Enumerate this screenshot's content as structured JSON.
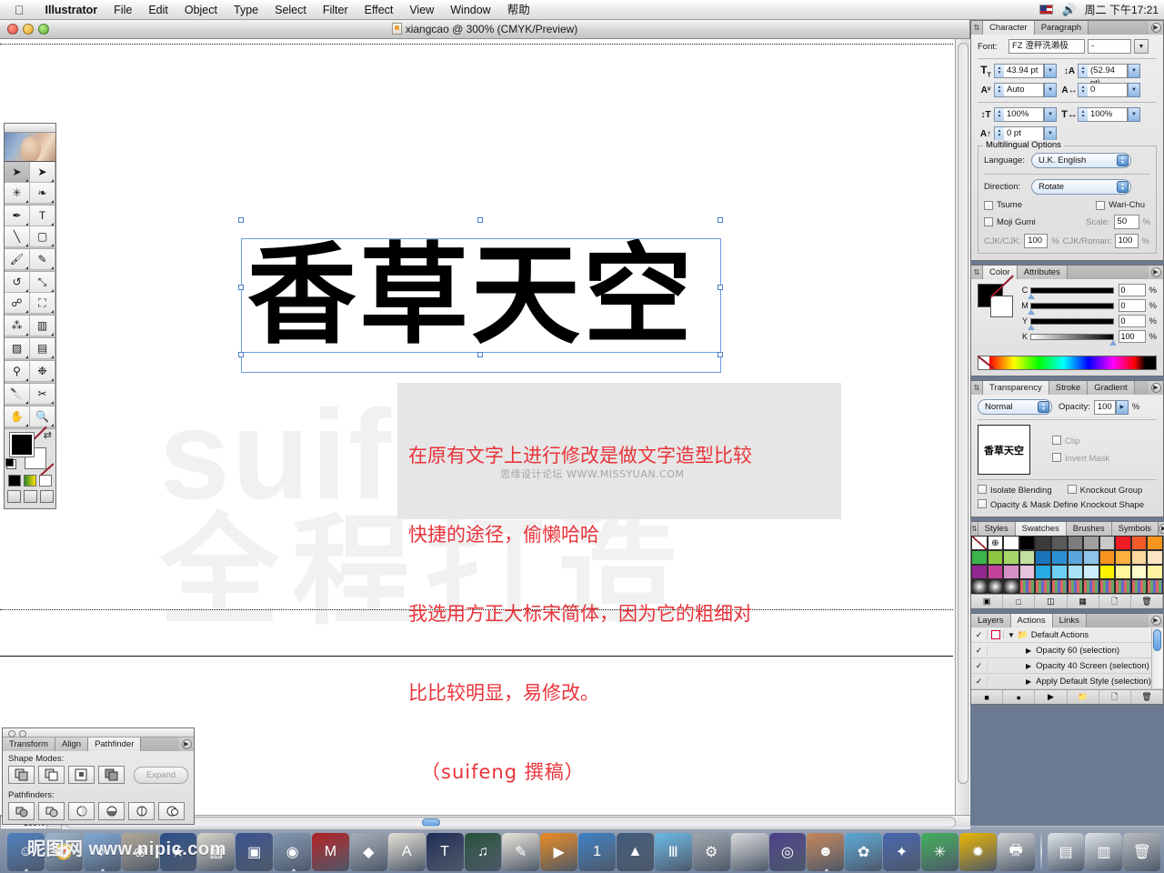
{
  "menubar": {
    "apple": "apple-logo",
    "items": [
      "Illustrator",
      "File",
      "Edit",
      "Object",
      "Type",
      "Select",
      "Filter",
      "Effect",
      "View",
      "Window",
      "帮助"
    ],
    "clock": "周二 下午17:21"
  },
  "document": {
    "title": "xiangcao @ 300% (CMYK/Preview)",
    "artwork_text": "香草天空",
    "zoom_field": "300%",
    "background_watermark_line1": "suifeng",
    "background_watermark_line2": "全程打造",
    "annotation": {
      "line1": "在原有文字上进行修改是做文字造型比较",
      "line2": "快捷的途径，偷懒哈哈",
      "line3": "我选用方正大标宋简体，因为它的粗细对",
      "line4": "比比较明显，易修改。",
      "line5": "（suifeng 撰稿）"
    },
    "forum_watermark": "思缘设计论坛 WWW.MISSYUAN.COM"
  },
  "toolbox": {
    "tools": [
      {
        "name": "selection-tool",
        "glyph": "➤",
        "selected": true
      },
      {
        "name": "direct-selection-tool",
        "glyph": "➤",
        "selected": false
      },
      {
        "name": "magic-wand-tool",
        "glyph": "✳",
        "selected": false
      },
      {
        "name": "lasso-tool",
        "glyph": "❧",
        "selected": false
      },
      {
        "name": "pen-tool",
        "glyph": "✒",
        "selected": false
      },
      {
        "name": "type-tool",
        "glyph": "T",
        "selected": false
      },
      {
        "name": "line-segment-tool",
        "glyph": "╲",
        "selected": false
      },
      {
        "name": "rectangle-tool",
        "glyph": "▢",
        "selected": false
      },
      {
        "name": "paintbrush-tool",
        "glyph": "🖌",
        "selected": false
      },
      {
        "name": "pencil-tool",
        "glyph": "✎",
        "selected": false
      },
      {
        "name": "rotate-tool",
        "glyph": "↺",
        "selected": false
      },
      {
        "name": "scale-tool",
        "glyph": "⤡",
        "selected": false
      },
      {
        "name": "warp-tool",
        "glyph": "☍",
        "selected": false
      },
      {
        "name": "free-transform-tool",
        "glyph": "⛶",
        "selected": false
      },
      {
        "name": "symbol-sprayer-tool",
        "glyph": "⁂",
        "selected": false
      },
      {
        "name": "column-graph-tool",
        "glyph": "▥",
        "selected": false
      },
      {
        "name": "mesh-tool",
        "glyph": "▨",
        "selected": false
      },
      {
        "name": "gradient-tool",
        "glyph": "▤",
        "selected": false
      },
      {
        "name": "eyedropper-tool",
        "glyph": "⚲",
        "selected": false
      },
      {
        "name": "blend-tool",
        "glyph": "❉",
        "selected": false
      },
      {
        "name": "slice-tool",
        "glyph": "🔪",
        "selected": false
      },
      {
        "name": "scissors-tool",
        "glyph": "✂",
        "selected": false
      },
      {
        "name": "hand-tool",
        "glyph": "✋",
        "selected": false
      },
      {
        "name": "zoom-tool",
        "glyph": "🔍",
        "selected": false
      }
    ],
    "fill_color": "#000000",
    "stroke_color": "#ffffff"
  },
  "character_panel": {
    "tabs": [
      "Character",
      "Paragraph"
    ],
    "active_tab": "Character",
    "font_label": "Font:",
    "font_value": "FZ 澄秤洗濑极",
    "font_style": "-",
    "size": "43.94 pt",
    "leading": "(52.94 pt)",
    "kerning": "Auto",
    "tracking": "0",
    "vertical_scale": "100%",
    "horizontal_scale": "100%",
    "baseline_shift": "0 pt",
    "multilingual_label": "Multilingual Options",
    "language_label": "Language:",
    "language_value": "U.K. English",
    "direction_label": "Direction:",
    "direction_value": "Rotate",
    "tsume_label": "Tsume",
    "warichu_label": "Wari-Chu",
    "mojigumi_label": "Moji Gumi",
    "scale_label": "Scale:",
    "scale_value": "50",
    "cjkcjk_label": "CJK/CJK:",
    "cjkcjk_value": "100",
    "cjkroman_label": "CJK/Roman:",
    "cjkroman_value": "100",
    "percent": "%"
  },
  "color_panel": {
    "tabs": [
      "Color",
      "Attributes"
    ],
    "active_tab": "Color",
    "channels": [
      {
        "letter": "C",
        "value": "0",
        "pos": 0
      },
      {
        "letter": "M",
        "value": "0",
        "pos": 0
      },
      {
        "letter": "Y",
        "value": "0",
        "pos": 0
      },
      {
        "letter": "K",
        "value": "100",
        "pos": 100
      }
    ],
    "unit": "%"
  },
  "transparency_panel": {
    "tabs": [
      "Transparency",
      "Stroke",
      "Gradient"
    ],
    "active_tab": "Transparency",
    "blend_mode": "Normal",
    "opacity_label": "Opacity:",
    "opacity_value": "100",
    "percent": "%",
    "thumbnail_text": "香草天空",
    "clip_label": "Clip",
    "invert_mask_label": "Invert Mask",
    "isolate_blending_label": "Isolate Blending",
    "knockout_group_label": "Knockout Group",
    "opacity_mask_label": "Opacity & Mask Define Knockout Shape"
  },
  "swatches_panel": {
    "tabs": [
      "Styles",
      "Swatches",
      "Brushes",
      "Symbols"
    ],
    "active_tab": "Swatches",
    "colors": [
      "none",
      "registration",
      "#ffffff",
      "#000000",
      "#3c3c3c",
      "#5a5a5a",
      "#7d7d7d",
      "#a0a0a0",
      "#c8c8c8",
      "#ee1c25",
      "#f15a29",
      "#f7941e",
      "#39b54a",
      "#8dc63f",
      "#a7d66a",
      "#c4e0a0",
      "#1b75bc",
      "#2b8fd4",
      "#5ba7dd",
      "#8fc3e8",
      "#f7941e",
      "#fbb040",
      "#fcd7a0",
      "#fde4c2",
      "#92278f",
      "#c2429a",
      "#d58fc4",
      "#e8c3df",
      "#27aae1",
      "#6dcff6",
      "#a9e0f7",
      "#cceefc",
      "#fff200",
      "#fff799",
      "#fffbcc",
      "#fdf3a0",
      "gradient1",
      "gradient2",
      "gradient3",
      "pattern1",
      "pattern2",
      "pattern3",
      "pattern4",
      "pattern5",
      "pattern6",
      "pattern7",
      "pattern8",
      "pattern9"
    ]
  },
  "actions_panel": {
    "tabs": [
      "Layers",
      "Actions",
      "Links"
    ],
    "active_tab": "Actions",
    "rows": [
      {
        "check": "✓",
        "label": "Default Actions",
        "type": "folder",
        "expanded": true
      },
      {
        "check": "✓",
        "label": "Opacity 60 (selection)",
        "type": "action"
      },
      {
        "check": "✓",
        "label": "Opacity 40 Screen (selection)",
        "type": "action"
      },
      {
        "check": "✓",
        "label": "Apply Default Style (selection)",
        "type": "action"
      }
    ]
  },
  "pathfinder_panel": {
    "tabs": [
      "Transform",
      "Align",
      "Pathfinder"
    ],
    "active_tab": "Pathfinder",
    "shape_modes_label": "Shape Modes:",
    "pathfinders_label": "Pathfinders:",
    "expand_label": "Expand"
  },
  "dock": {
    "watermark": "昵图网 www.nipic.com",
    "items": [
      {
        "name": "finder",
        "color": "#4c7fc0",
        "glyph": "☺"
      },
      {
        "name": "safari",
        "color": "#9fb8cf",
        "glyph": "🧭"
      },
      {
        "name": "itunes",
        "color": "#7fa8d8",
        "glyph": "♪"
      },
      {
        "name": "iphoto",
        "color": "#b0a998",
        "glyph": "❀"
      },
      {
        "name": "imovie",
        "color": "#2a4e8a",
        "glyph": "★"
      },
      {
        "name": "final-cut",
        "color": "#d9d5cc",
        "glyph": "▤"
      },
      {
        "name": "dvd-studio",
        "color": "#38518f",
        "glyph": "▣"
      },
      {
        "name": "shake",
        "color": "#7f96b2",
        "glyph": "◉"
      },
      {
        "name": "maya",
        "color": "#b11f24",
        "glyph": "M"
      },
      {
        "name": "modeler",
        "color": "#a5adb8",
        "glyph": "◆"
      },
      {
        "name": "pagemaker",
        "color": "#e3e0d6",
        "glyph": "A"
      },
      {
        "name": "after-effects",
        "color": "#1d2a55",
        "glyph": "T"
      },
      {
        "name": "soundtrack",
        "color": "#24503a",
        "glyph": "♫"
      },
      {
        "name": "textedit",
        "color": "#e8e4da",
        "glyph": "✎"
      },
      {
        "name": "quicktime",
        "color": "#e98a1f",
        "glyph": "▶"
      },
      {
        "name": "onebutton",
        "color": "#3b7fc4",
        "glyph": "1"
      },
      {
        "name": "vlc",
        "color": "#3e5a7a",
        "glyph": "▲"
      },
      {
        "name": "illustrator",
        "color": "#68b8e8",
        "glyph": "Ⅲ"
      },
      {
        "name": "system-prefs",
        "color": "#9fa6ae",
        "glyph": "⚙"
      },
      {
        "name": "apple-store",
        "color": "#d9dbdd",
        "glyph": ""
      },
      {
        "name": "sherlock",
        "color": "#4a3f8a",
        "glyph": "◎"
      },
      {
        "name": "venus-image",
        "color": "#c4845a",
        "glyph": "☻"
      },
      {
        "name": "photoshop-splat",
        "color": "#5aa8d8",
        "glyph": "✿"
      },
      {
        "name": "imageready",
        "color": "#4464b0",
        "glyph": "✦"
      },
      {
        "name": "greensplat",
        "color": "#3fae5a",
        "glyph": "✳"
      },
      {
        "name": "goldsplat",
        "color": "#e8b400",
        "glyph": "✹"
      },
      {
        "name": "printer",
        "color": "#d2d4d6",
        "glyph": "🖶"
      },
      {
        "name": "folder-window-1",
        "color": "#dfe4ea",
        "glyph": "▤"
      },
      {
        "name": "folder-window-2",
        "color": "#dfe4ea",
        "glyph": "▥"
      },
      {
        "name": "trash",
        "color": "#b8bcc2",
        "glyph": "🗑"
      }
    ]
  }
}
